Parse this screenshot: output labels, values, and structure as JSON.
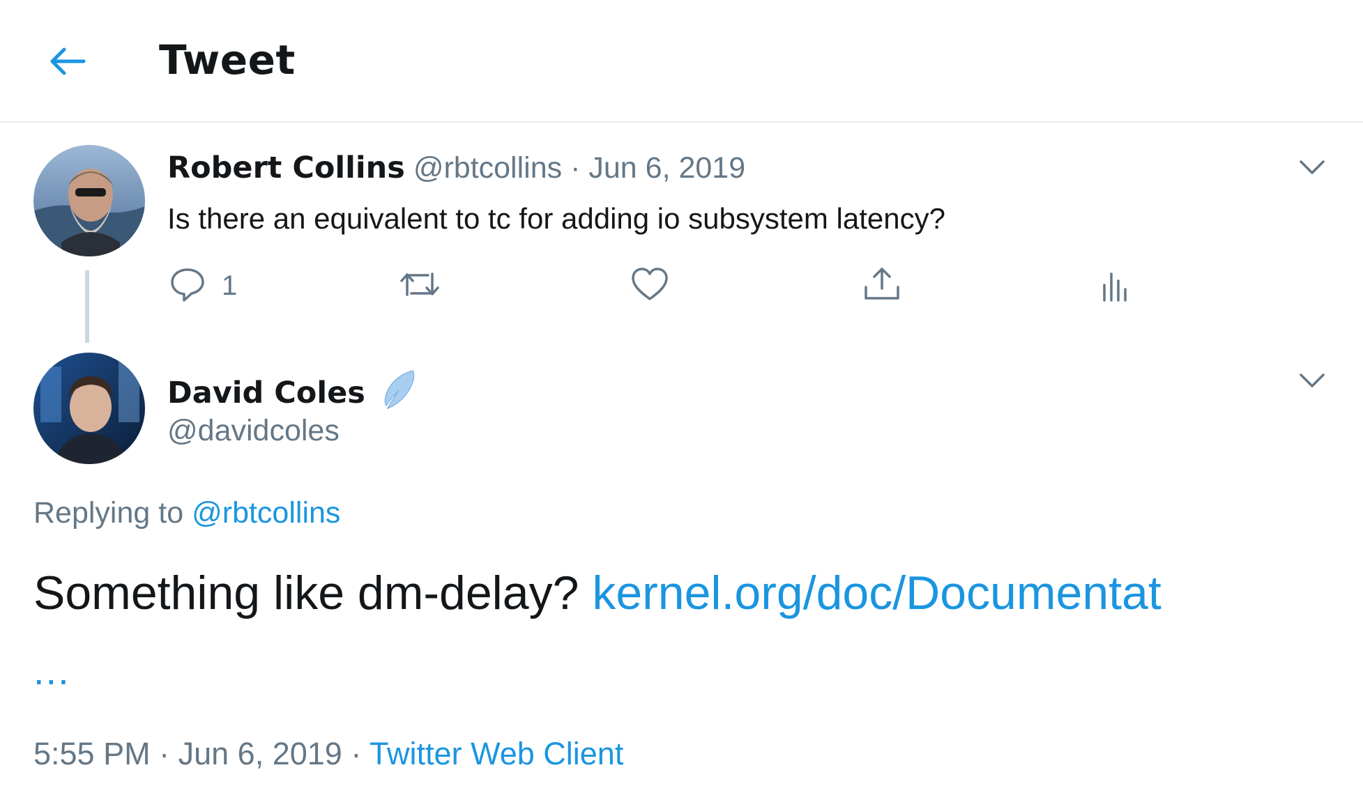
{
  "header": {
    "title": "Tweet",
    "back_icon": "arrow-left-icon"
  },
  "colors": {
    "accent": "#1b95e0",
    "text": "#14171a",
    "muted": "#657786",
    "border": "#e6ecf0"
  },
  "parent_tweet": {
    "name": "Robert Collins",
    "handle": "@rbtcollins",
    "separator": "·",
    "date": "Jun 6, 2019",
    "text": "Is there an equivalent to tc for adding io subsystem latency?",
    "reply_count": "1",
    "icons": [
      "reply-icon",
      "retweet-icon",
      "like-icon",
      "share-icon",
      "analytics-icon",
      "chevron-down-icon"
    ]
  },
  "reply_tweet": {
    "name": "David Coles",
    "handle": "@davidcoles",
    "badge_icon": "feather-icon",
    "replying_prefix": "Replying to",
    "replying_handle": "@rbtcollins",
    "text": "Something like dm-delay?",
    "link_text": "kernel.org/doc/Documentat",
    "link_ellipsis": "...",
    "time": "5:55 PM",
    "separator": "·",
    "date": "Jun 6, 2019",
    "source": "Twitter Web Client"
  }
}
